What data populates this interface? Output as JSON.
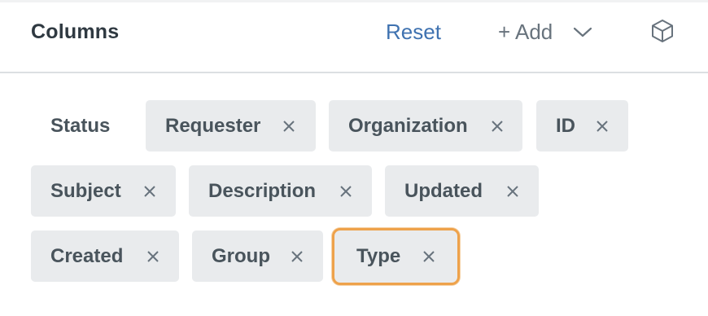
{
  "header": {
    "title": "Columns",
    "reset_label": "Reset",
    "add_label": "+ Add"
  },
  "columns": {
    "status": "Status",
    "requester": "Requester",
    "organization": "Organization",
    "id": "ID",
    "subject": "Subject",
    "description": "Description",
    "updated": "Updated",
    "created": "Created",
    "group": "Group",
    "type": "Type"
  },
  "colors": {
    "accent_link": "#3f72b0",
    "chip_bg": "#e9ebed",
    "selected_outline": "#eea24b"
  },
  "icons": {
    "add_dropdown": "chevron-down-icon",
    "view": "cube-icon",
    "remove": "close-icon"
  }
}
